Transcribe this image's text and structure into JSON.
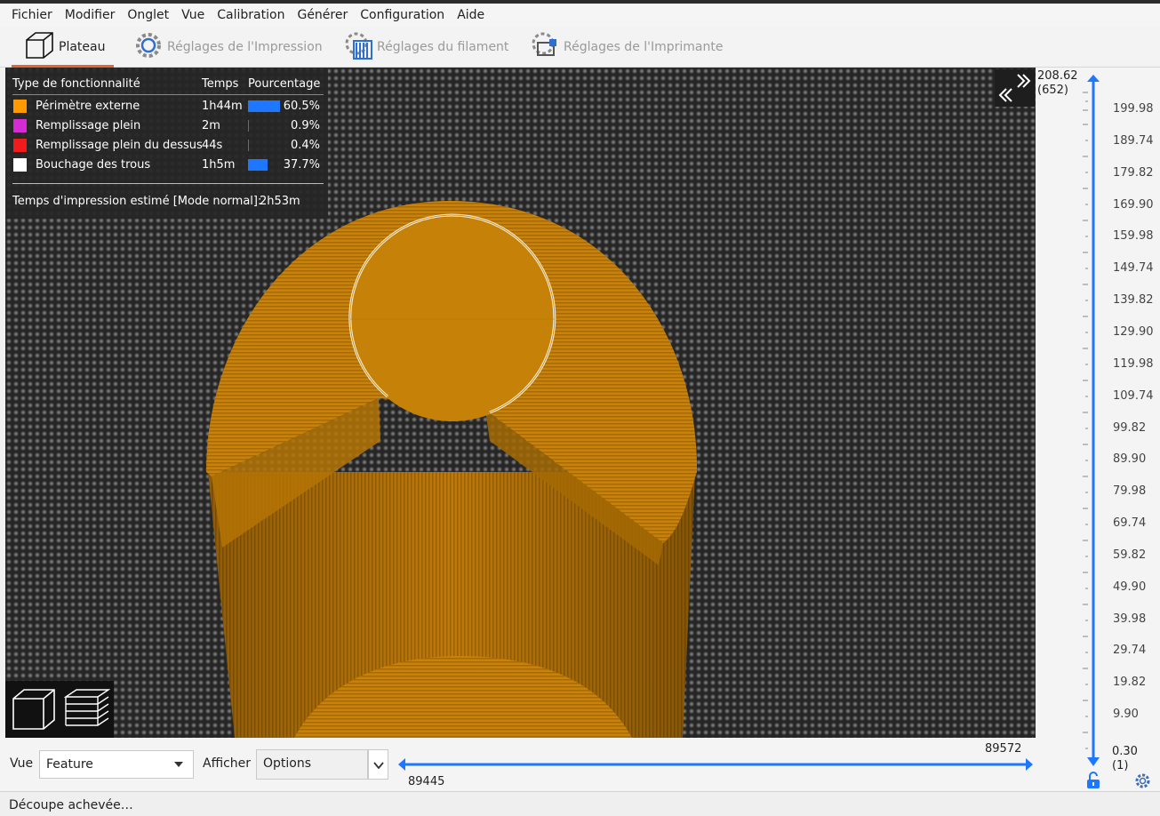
{
  "menu": [
    "Fichier",
    "Modifier",
    "Onglet",
    "Vue",
    "Calibration",
    "Générer",
    "Configuration",
    "Aide"
  ],
  "tabs": {
    "plate": "Plateau",
    "print": "Réglages de l'Impression",
    "filament": "Réglages du filament",
    "printer": "Réglages de l'Imprimante"
  },
  "legend": {
    "col_type": "Type de fonctionnalité",
    "col_time": "Temps",
    "col_pct": "Pourcentage",
    "rows": [
      {
        "name": "Périmètre externe",
        "time": "1h44m",
        "pct": "60.5%",
        "value": 60.5,
        "color": "#ff9a00"
      },
      {
        "name": "Remplissage plein",
        "time": "2m",
        "pct": "0.9%",
        "value": 0.9,
        "color": "#d42bd4"
      },
      {
        "name": "Remplissage plein du dessus",
        "time": "44s",
        "pct": "0.4%",
        "value": 0.4,
        "color": "#f21b1b"
      },
      {
        "name": "Bouchage des trous",
        "time": "1h5m",
        "pct": "37.7%",
        "value": 37.7,
        "color": "#ffffff"
      }
    ],
    "estimate_label": "Temps d'impression estimé [Mode normal]:",
    "estimate_value": "2h53m"
  },
  "layer_slider": {
    "top_value": "208.62",
    "top_layer": "(652)",
    "ticks": [
      "199.98",
      "189.74",
      "179.82",
      "169.90",
      "159.98",
      "149.74",
      "139.82",
      "129.90",
      "119.98",
      "109.74",
      "99.82",
      "89.90",
      "79.98",
      "69.74",
      "59.82",
      "49.90",
      "39.98",
      "29.74",
      "19.82",
      "9.90"
    ],
    "bottom_value": "0.30",
    "bottom_layer": "(1)"
  },
  "bottom": {
    "view_label": "Vue",
    "view_value": "Feature",
    "show_label": "Afficher",
    "show_value": "Options",
    "move_left": "89445",
    "move_right": "89572"
  },
  "status": "Découpe achevée…",
  "colors": {
    "accent": "#e4662f",
    "slider": "#1e78ff",
    "model": "#d68a0f"
  }
}
